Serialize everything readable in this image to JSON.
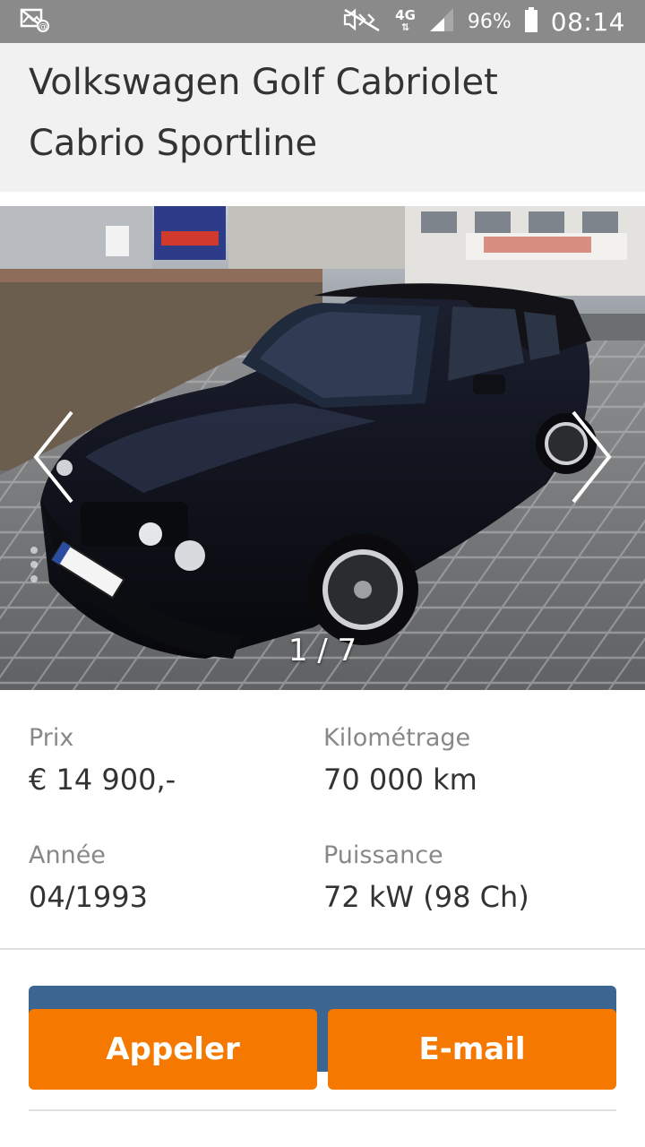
{
  "status_bar": {
    "network": "4G",
    "battery": "96%",
    "time": "08:14"
  },
  "listing": {
    "title_line1": "Volkswagen Golf Cabriolet",
    "title_line2": "Cabrio Sportline"
  },
  "gallery": {
    "counter": "1 / 7",
    "icons": [
      "chevron-left-icon",
      "chevron-right-icon"
    ]
  },
  "specs": {
    "price_label": "Prix",
    "price_value": "€ 14 900,-",
    "mileage_label": "Kilométrage",
    "mileage_value": "70 000 km",
    "year_label": "Année",
    "year_value": "04/1993",
    "power_label": "Puissance",
    "power_value": "72 kW (98 Ch)"
  },
  "actions": {
    "call_label": "Appeler",
    "email_label": "E-mail"
  },
  "colors": {
    "accent": "#f57800",
    "secondary_button": "#3d6592",
    "status_bar": "#8a8a8a"
  }
}
